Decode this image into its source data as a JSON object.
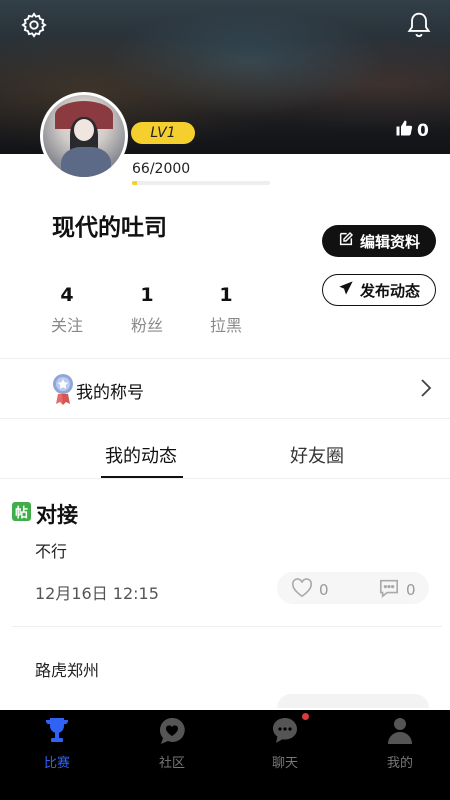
{
  "profile": {
    "likes": "0",
    "level": "LV1",
    "exp_text": "66/2000",
    "exp_progress": 0.033,
    "nickname": "现代的吐司"
  },
  "actions": {
    "edit_label": "编辑资料",
    "post_label": "发布动态"
  },
  "stats": [
    {
      "value": "4",
      "label": "关注"
    },
    {
      "value": "1",
      "label": "粉丝"
    },
    {
      "value": "1",
      "label": "拉黑"
    }
  ],
  "title_row": {
    "label": "我的称号"
  },
  "tabs": [
    {
      "label": "我的动态",
      "active": true
    },
    {
      "label": "好友圈",
      "active": false
    }
  ],
  "posts": [
    {
      "tag": "帖",
      "title": "对接",
      "body": "不行",
      "time": "12月16日 12:15",
      "like_count": "0",
      "comment_count": "0"
    },
    {
      "body": "路虎郑州"
    }
  ],
  "bottom_nav": [
    {
      "label": "比赛",
      "icon": "trophy-icon",
      "active": true
    },
    {
      "label": "社区",
      "icon": "heart-chat-icon",
      "active": false
    },
    {
      "label": "聊天",
      "icon": "chat-bubble-icon",
      "active": false,
      "badge": true
    },
    {
      "label": "我的",
      "icon": "user-icon",
      "active": false
    }
  ],
  "colors": {
    "accent_blue": "#2f62f5",
    "level_yellow": "#f5cf2e",
    "post_tag_green": "#3fae49",
    "badge_red": "#e03a3a"
  }
}
